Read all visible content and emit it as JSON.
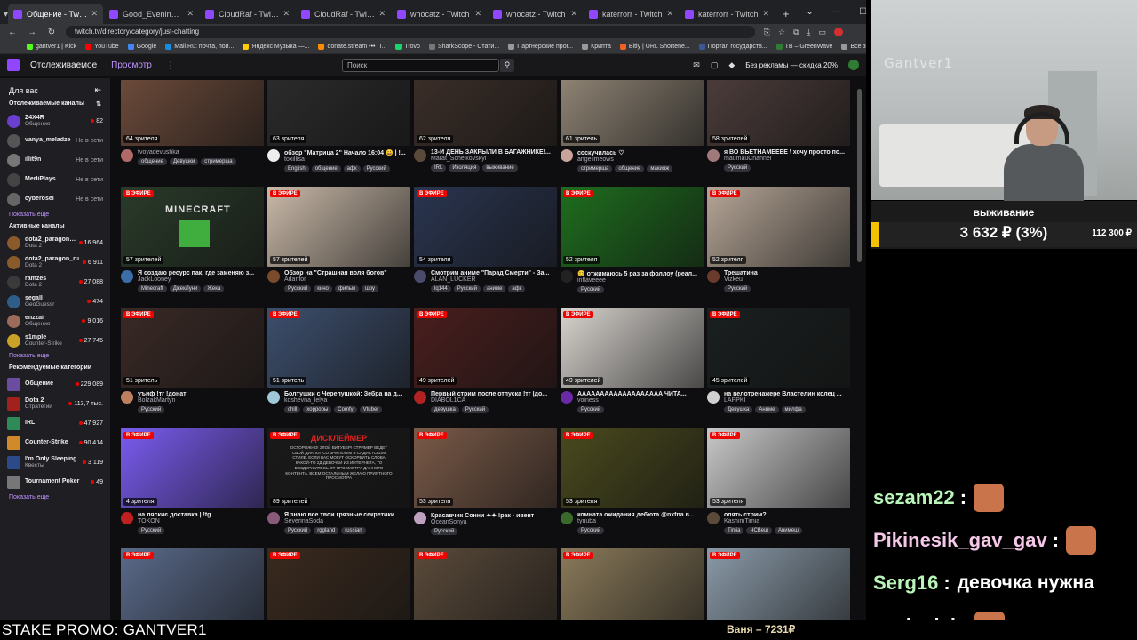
{
  "browser": {
    "tabs": [
      {
        "title": "Общение - Twitch",
        "active": true
      },
      {
        "title": "Good_Evening_VT - Twitch",
        "active": false
      },
      {
        "title": "CloudRaf - Twitch",
        "active": false
      },
      {
        "title": "CloudRaf - Twitch",
        "active": false
      },
      {
        "title": "whocatz - Twitch",
        "active": false
      },
      {
        "title": "whocatz - Twitch",
        "active": false
      },
      {
        "title": "katerrorr - Twitch",
        "active": false
      },
      {
        "title": "katerrorr - Twitch",
        "active": false
      }
    ],
    "url": "twitch.tv/directory/category/just-chatting",
    "bookmarks": [
      {
        "label": "gantver1 | Kick",
        "color": "#53fc18"
      },
      {
        "label": "YouTube",
        "color": "#ff0000"
      },
      {
        "label": "Google",
        "color": "#4285f4"
      },
      {
        "label": "Mail.Ru: почта, пои...",
        "color": "#168de2"
      },
      {
        "label": "Яндекс Музыка —...",
        "color": "#ffcc00"
      },
      {
        "label": "donate.stream ••• П...",
        "color": "#ff8c00"
      },
      {
        "label": "Trovo",
        "color": "#19d66b"
      },
      {
        "label": "SharkScope - Стати...",
        "color": "#777777"
      },
      {
        "label": "Партнерские прог...",
        "color": "#999999"
      },
      {
        "label": "Крипта",
        "color": "#999999"
      },
      {
        "label": "Bitly | URL Shortene...",
        "color": "#ee6123"
      },
      {
        "label": "Портал государств...",
        "color": "#3b5998"
      },
      {
        "label": "TB – GreenWave",
        "color": "#2e7d32"
      },
      {
        "label": "Все закладки",
        "color": "#999999"
      }
    ]
  },
  "twitch": {
    "nav_following": "Отслеживаемое",
    "nav_browse": "Просмотр",
    "search_placeholder": "Поиск",
    "promo": "Без рекламы — скидка 20%",
    "sidebar": {
      "for_you": "Для вас",
      "followed_header": "Отслеживаемые каналы",
      "followed": [
        {
          "name": "Z4X4R",
          "sub": "Общение",
          "right": "82",
          "live": true,
          "color": "#6a3fd0"
        },
        {
          "name": "vanya_meladze",
          "sub": "",
          "right": "Не в сети",
          "live": false,
          "color": "#555"
        },
        {
          "name": "illit9n",
          "sub": "",
          "right": "Не в сети",
          "live": false,
          "color": "#777"
        },
        {
          "name": "MerliPlays",
          "sub": "",
          "right": "Не в сети",
          "live": false,
          "color": "#444"
        },
        {
          "name": "cyberosel",
          "sub": "",
          "right": "Не в сети",
          "live": false,
          "color": "#666"
        }
      ],
      "show_more": "Показать еще",
      "live_header": "Активные каналы",
      "live": [
        {
          "name": "dota2_paragon_ru",
          "sub": "Dota 2",
          "right": "16 964",
          "color": "#8a5a2b"
        },
        {
          "name": "dota2_paragon_ru",
          "sub": "Dota 2",
          "right": "6 911",
          "color": "#8a5a2b"
        },
        {
          "name": "ramzes",
          "sub": "Dota 2",
          "right": "27 088",
          "color": "#3a3a3a"
        },
        {
          "name": "segall",
          "sub": "GeoGuessr",
          "right": "474",
          "color": "#2f5d8a"
        },
        {
          "name": "enzzai",
          "sub": "Общение",
          "right": "9 016",
          "color": "#9c6b5a"
        },
        {
          "name": "s1mple",
          "sub": "Counter-Strike",
          "right": "27 745",
          "color": "#c9a227"
        }
      ],
      "rec_header": "Рекомендуемые категории",
      "categories": [
        {
          "name": "Общение",
          "sub": "",
          "right": "229 089",
          "color": "#6a4ca0"
        },
        {
          "name": "Dota 2",
          "sub": "Стратегии",
          "right": "113,7 тыс.",
          "color": "#a1221c"
        },
        {
          "name": "IRL",
          "sub": "",
          "right": "47 927",
          "color": "#2e8b57"
        },
        {
          "name": "Counter-Strike",
          "sub": "",
          "right": "90 414",
          "color": "#d18a2a"
        },
        {
          "name": "I'm Only Sleeping",
          "sub": "Квесты",
          "right": "3 119",
          "color": "#2a4a8a"
        },
        {
          "name": "Tournament Poker",
          "sub": "",
          "right": "49",
          "color": "#777777"
        }
      ]
    },
    "live_label": "В ЭФИРЕ",
    "cards": [
      {
        "viewers": "64 зрителя",
        "title": "",
        "channel": "tvoyadevushka",
        "tags": [
          "общение",
          "Девушки",
          "стримерша"
        ],
        "live": false,
        "color": "#6b4a3a",
        "ava": "#b06a6a"
      },
      {
        "viewers": "63 зрителя",
        "title": "обзор \"Матрица 2\" Начало 16:04 😀 | !...",
        "channel": "toxillisa",
        "tags": [
          "English",
          "общение",
          "афк",
          "Русский"
        ],
        "live": false,
        "color": "#2b2b2b",
        "ava": "#eeeeee"
      },
      {
        "viewers": "62 зрителя",
        "title": "13-Й ДЕНЬ ЗАКРЫЛИ В БАГАЖНИКЕ!...",
        "channel": "Marat_Schelkovskyi",
        "tags": [
          "IRL",
          "Изоляция",
          "выживание"
        ],
        "live": false,
        "color": "#3a2e28",
        "ava": "#5a4a3a"
      },
      {
        "viewers": "61 зритель",
        "title": "соскучилась ♡",
        "channel": "angelimeows",
        "tags": [
          "стримерша",
          "общение",
          "макияж"
        ],
        "live": false,
        "color": "#8e8374",
        "ava": "#c9a49a"
      },
      {
        "viewers": "58 зрителей",
        "title": "я ВО ВЬЕТНАМЕЕЕЕ \\ хочу просто по...",
        "channel": "maumauChannel",
        "tags": [
          "Русский"
        ],
        "live": false,
        "color": "#4b3c3a",
        "ava": "#a07a7a"
      },
      {
        "viewers": "57 зрителей",
        "title": "Я создаю ресурс пак, где заменяю з...",
        "channel": "JackLooney",
        "tags": [
          "Minecraft",
          "ДжекЛуни",
          "Жека"
        ],
        "live": true,
        "color": "#2a3b2a",
        "ava": "#3b6ea8"
      },
      {
        "viewers": "57 зрителей",
        "title": "Обзор на \"Страшная воля богов\"",
        "channel": "Adanfor",
        "tags": [
          "Русский",
          "кино",
          "фильм",
          "шоу"
        ],
        "live": true,
        "color": "#c9b9a8",
        "ava": "#7a4a2a"
      },
      {
        "viewers": "54 зрителя",
        "title": "Смотрим аниме \"Парад Смерти\" - За...",
        "channel": "ALAN_LUCKER",
        "tags": [
          "lq144",
          "Русский",
          "аниме",
          "афк"
        ],
        "live": true,
        "color": "#2a3550",
        "ava": "#4a4a6a"
      },
      {
        "viewers": "52 зрителя",
        "title": "😊 отжимаюсь 5 раз за фоллоу (реал...",
        "channel": "inflaveeee",
        "tags": [
          "Русский"
        ],
        "live": true,
        "color": "#1e6e1e",
        "ava": "#222222"
      },
      {
        "viewers": "52 зрителя",
        "title": "Трешатина",
        "channel": "Vizkeu",
        "tags": [
          "Русский"
        ],
        "live": true,
        "color": "#b5a596",
        "ava": "#6a3a2a"
      },
      {
        "viewers": "51 зритель",
        "title": "уъиф !тг !донат",
        "channel": "BolzakMartyn",
        "tags": [
          "Русский"
        ],
        "live": true,
        "color": "#3a2a26",
        "ava": "#c08060"
      },
      {
        "viewers": "51 зритель",
        "title": "Болтушки с Черепушкой: Зебра на д...",
        "channel": "koshevna_lelya",
        "tags": [
          "chill",
          "хорроры",
          "Comfy",
          "Vtuber"
        ],
        "live": true,
        "color": "#3d4f6e",
        "ava": "#a0c8d8"
      },
      {
        "viewers": "49 зрителей",
        "title": "Первый стрим после отпуска !тг |до...",
        "channel": "DIABOL1CA",
        "tags": [
          "девушка",
          "Русский"
        ],
        "live": true,
        "color": "#4a1e1e",
        "ava": "#b22222"
      },
      {
        "viewers": "49 зрителей",
        "title": "ААААААААААААААААААА ЧИТА...",
        "channel": "voiness",
        "tags": [
          "Русский"
        ],
        "live": true,
        "color": "#d8d4cf",
        "ava": "#6a2aa8"
      },
      {
        "viewers": "45 зрителей",
        "title": "на велотренажере Властелин колец ...",
        "channel": "LAPPKI",
        "tags": [
          "Девушка",
          "Аниме",
          "милфа"
        ],
        "live": true,
        "color": "#1a1f1f",
        "ava": "#d0d0d0"
      },
      {
        "viewers": "4 зрителя",
        "title": "на ляскиє доставка | !tg",
        "channel": "TOKON_",
        "tags": [
          "Русский"
        ],
        "live": true,
        "color": "#7a5cf0",
        "ava": "#c02020"
      },
      {
        "viewers": "89 зрителей",
        "title": "Я знаю все твои грязные секретики",
        "channel": "SeverinaSoda",
        "tags": [
          "Русский",
          "rggland",
          "russian"
        ],
        "live": true,
        "color": "#1a1a1a",
        "ava": "#8a5a7a"
      },
      {
        "viewers": "53 зрителя",
        "title": "Красавчик Сонни ✦✦ !рак - ивент",
        "channel": "OceanSonya",
        "tags": [
          "Русский"
        ],
        "live": true,
        "color": "#7a5a48",
        "ava": "#c0a0c0"
      },
      {
        "viewers": "53 зрителя",
        "title": "комната ожидания дебюта @nxfna в...",
        "channel": "tyuuba",
        "tags": [
          "Русский"
        ],
        "live": true,
        "color": "#4a4a1e",
        "ava": "#3a6a2a"
      },
      {
        "viewers": "53 зрителя",
        "title": "опять стрим?",
        "channel": "KashimTimia",
        "tags": [
          "Timia",
          "ЧСВеш",
          "Анимеш"
        ],
        "live": true,
        "color": "#c8c8c8",
        "ava": "#5a4a3a"
      },
      {
        "viewers": "",
        "title": "",
        "channel": "",
        "tags": [],
        "live": true,
        "color": "#5a6a8a",
        "ava": ""
      },
      {
        "viewers": "",
        "title": "",
        "channel": "",
        "tags": [],
        "live": true,
        "color": "#3a2a1e",
        "ava": ""
      },
      {
        "viewers": "",
        "title": "",
        "channel": "",
        "tags": [],
        "live": true,
        "color": "#5a4a3a",
        "ava": ""
      },
      {
        "viewers": "",
        "title": "",
        "channel": "",
        "tags": [],
        "live": true,
        "color": "#8a7a5a",
        "ava": ""
      },
      {
        "viewers": "",
        "title": "",
        "channel": "",
        "tags": [],
        "live": true,
        "color": "#8a9aa8",
        "ava": ""
      }
    ],
    "minecraft_text": "MINECRAFT",
    "warning_title": "ДИСКЛЕЙМЕР",
    "warning_body": "ОСТОРОЖНО! ЗЛОЙ ВИТУБЕР! СТРИМЕР ВЕДЕТ СВОЙ ДИАЛОГ СО ЗРИТЕЛЕМ В САДИСТСКОМ СТИЛЕ. ЕСЛИ ВАС МОГУТ ОСКОРБИТЬ СЛОВА КАКОЙ-ТО 2Д ДЕВОЧКИ ИЗ ИНТЕРНЕТА, ТО ВОЗДЕРЖИТЕСЬ ОТ ПРОСМОТРА ДАННОГО КОНТЕНТА. ВСЕМ ОСТАЛЬНЫМ ЖЕЛАЮ ПРИЯТНОГО ПРОСМОТРА"
  },
  "overlay": {
    "watermark": "Gantver1",
    "goal_title": "выживание",
    "goal_amount": "3 632 ₽ (3%)",
    "goal_target": "112 300 ₽",
    "goal_progress": 0.03,
    "chat": [
      {
        "user": "sezam22",
        "color": "#b9f5b9",
        "msg": "",
        "emote": true
      },
      {
        "user": "Pikinesik_gav_gav",
        "color": "#f5c8e8",
        "msg": "",
        "emote": true
      },
      {
        "user": "Serg16",
        "color": "#b9f5b9",
        "msg": "девочка нужна",
        "emote": false
      },
      {
        "user": "casioclei",
        "color": "#f5f5f5",
        "msg": "",
        "emote": true
      }
    ],
    "promo": "STAKE PROMO: GANTVER1",
    "donor": "Ваня – 7231₽"
  }
}
